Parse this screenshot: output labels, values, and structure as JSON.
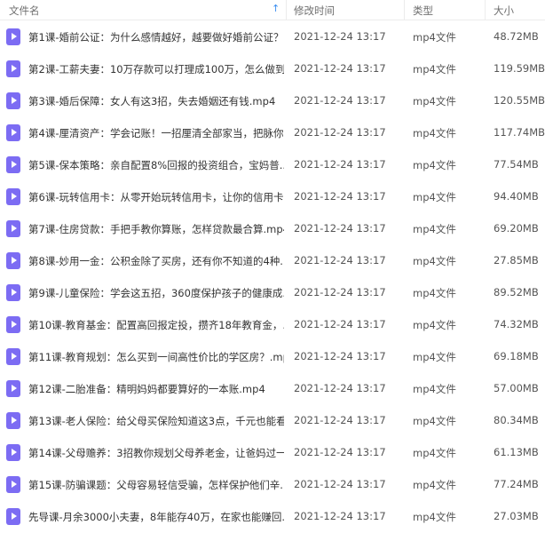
{
  "columns": {
    "name": "文件名",
    "modified": "修改时间",
    "type": "类型",
    "size": "大小"
  },
  "sort_icon": "sort-up-arrow-icon",
  "file_icon": "video-file-icon",
  "files": [
    {
      "name": "第1课-婚前公证：为什么感情越好，越要做好婚前公证？...",
      "modified": "2021-12-24 13:17",
      "type": "mp4文件",
      "size": "48.72MB"
    },
    {
      "name": "第2课-工薪夫妻：10万存款可以打理成100万，怎么做到...",
      "modified": "2021-12-24 13:17",
      "type": "mp4文件",
      "size": "119.59MB"
    },
    {
      "name": "第3课-婚后保障：女人有这3招，失去婚姻还有钱.mp4",
      "modified": "2021-12-24 13:17",
      "type": "mp4文件",
      "size": "120.55MB"
    },
    {
      "name": "第4课-厘清资产：学会记账！一招厘清全部家当，把脉你...",
      "modified": "2021-12-24 13:17",
      "type": "mp4文件",
      "size": "117.74MB"
    },
    {
      "name": "第5课-保本策略：亲自配置8%回报的投资组合，宝妈普...",
      "modified": "2021-12-24 13:17",
      "type": "mp4文件",
      "size": "77.54MB"
    },
    {
      "name": "第6课-玩转信用卡：从零开始玩转信用卡，让你的信用卡...",
      "modified": "2021-12-24 13:17",
      "type": "mp4文件",
      "size": "94.40MB"
    },
    {
      "name": "第7课-住房贷款：手把手教你算账，怎样贷款最合算.mp4",
      "modified": "2021-12-24 13:17",
      "type": "mp4文件",
      "size": "69.20MB"
    },
    {
      "name": "第8课-妙用一金：公积金除了买房，还有你不知道的4种...",
      "modified": "2021-12-24 13:17",
      "type": "mp4文件",
      "size": "27.85MB"
    },
    {
      "name": "第9课-儿童保险：学会这五招，360度保护孩子的健康成...",
      "modified": "2021-12-24 13:17",
      "type": "mp4文件",
      "size": "89.52MB"
    },
    {
      "name": "第10课-教育基金：配置高回报定投，攒齐18年教育金，...",
      "modified": "2021-12-24 13:17",
      "type": "mp4文件",
      "size": "74.32MB"
    },
    {
      "name": "第11课-教育规划：怎么买到一间高性价比的学区房？.mp4",
      "modified": "2021-12-24 13:17",
      "type": "mp4文件",
      "size": "69.18MB"
    },
    {
      "name": "第12课-二胎准备：精明妈妈都要算好的一本账.mp4",
      "modified": "2021-12-24 13:17",
      "type": "mp4文件",
      "size": "57.00MB"
    },
    {
      "name": "第13课-老人保险：给父母买保险知道这3点，千元也能看...",
      "modified": "2021-12-24 13:17",
      "type": "mp4文件",
      "size": "80.34MB"
    },
    {
      "name": "第14课-父母赡养：3招教你规划父母养老金，让爸妈过一...",
      "modified": "2021-12-24 13:17",
      "type": "mp4文件",
      "size": "61.13MB"
    },
    {
      "name": "第15课-防骗课题：父母容易轻信受骗，怎样保护他们辛...",
      "modified": "2021-12-24 13:17",
      "type": "mp4文件",
      "size": "77.24MB"
    },
    {
      "name": "先导课-月余3000小夫妻，8年能存40万，在家也能赚回...",
      "modified": "2021-12-24 13:17",
      "type": "mp4文件",
      "size": "27.03MB"
    }
  ]
}
